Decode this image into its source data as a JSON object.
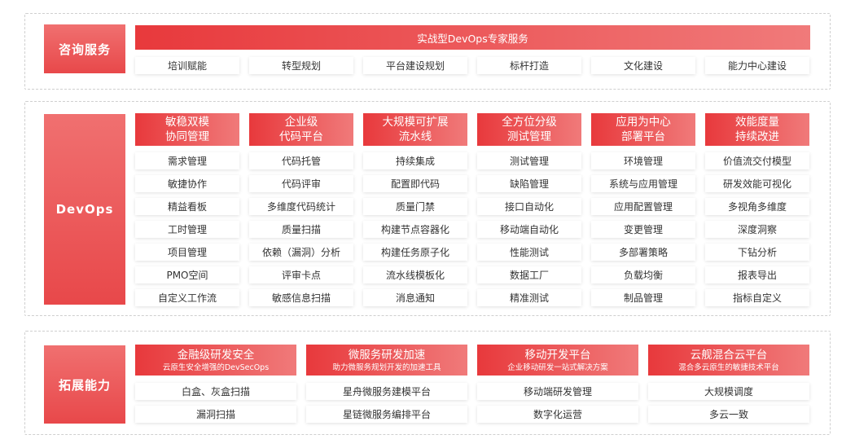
{
  "consulting": {
    "label": "咨询服务",
    "banner": "实战型DevOps专家服务",
    "items": [
      "培训赋能",
      "转型规划",
      "平台建设规划",
      "标杆打造",
      "文化建设",
      "能力中心建设"
    ]
  },
  "devops": {
    "label": "DevOps",
    "columns": [
      {
        "title": [
          "敏稳双模",
          "协同管理"
        ],
        "items": [
          "需求管理",
          "敏捷协作",
          "精益看板",
          "工时管理",
          "项目管理",
          "PMO空间",
          "自定义工作流"
        ]
      },
      {
        "title": [
          "企业级",
          "代码平台"
        ],
        "items": [
          "代码托管",
          "代码评审",
          "多维度代码统计",
          "质量扫描",
          "依赖（漏洞）分析",
          "评审卡点",
          "敏感信息扫描"
        ]
      },
      {
        "title": [
          "大规模可扩展",
          "流水线"
        ],
        "items": [
          "持续集成",
          "配置即代码",
          "质量门禁",
          "构建节点容器化",
          "构建任务原子化",
          "流水线模板化",
          "消息通知"
        ]
      },
      {
        "title": [
          "全方位分级",
          "测试管理"
        ],
        "items": [
          "测试管理",
          "缺陷管理",
          "接口自动化",
          "移动端自动化",
          "性能测试",
          "数据工厂",
          "精准测试"
        ]
      },
      {
        "title": [
          "应用为中心",
          "部署平台"
        ],
        "items": [
          "环境管理",
          "系统与应用管理",
          "应用配置管理",
          "变更管理",
          "多部署策略",
          "负载均衡",
          "制品管理"
        ]
      },
      {
        "title": [
          "效能度量",
          "持续改进"
        ],
        "items": [
          "价值流交付模型",
          "研发效能可视化",
          "多视角多维度",
          "深度洞察",
          "下钻分析",
          "报表导出",
          "指标自定义"
        ]
      }
    ]
  },
  "extension": {
    "label": "拓展能力",
    "columns": [
      {
        "title": "金融级研发安全",
        "subtitle": "云原生安全增强的DevSecOps",
        "items": [
          "白盒、灰盒扫描",
          "漏洞扫描"
        ]
      },
      {
        "title": "微服务研发加速",
        "subtitle": "助力微服务规划开发的加速工具",
        "items": [
          "星舟微服务建模平台",
          "星链微服务编排平台"
        ]
      },
      {
        "title": "移动开发平台",
        "subtitle": "企业移动研发一站式解决方案",
        "items": [
          "移动端研发管理",
          "数字化运营"
        ]
      },
      {
        "title": "云舰混合云平台",
        "subtitle": "混合多云原生的敏捷技术平台",
        "items": [
          "大规模调度",
          "多云一致"
        ]
      }
    ]
  },
  "colors": {
    "accent": "#e8393c",
    "accent_light": "#f07a7a"
  }
}
